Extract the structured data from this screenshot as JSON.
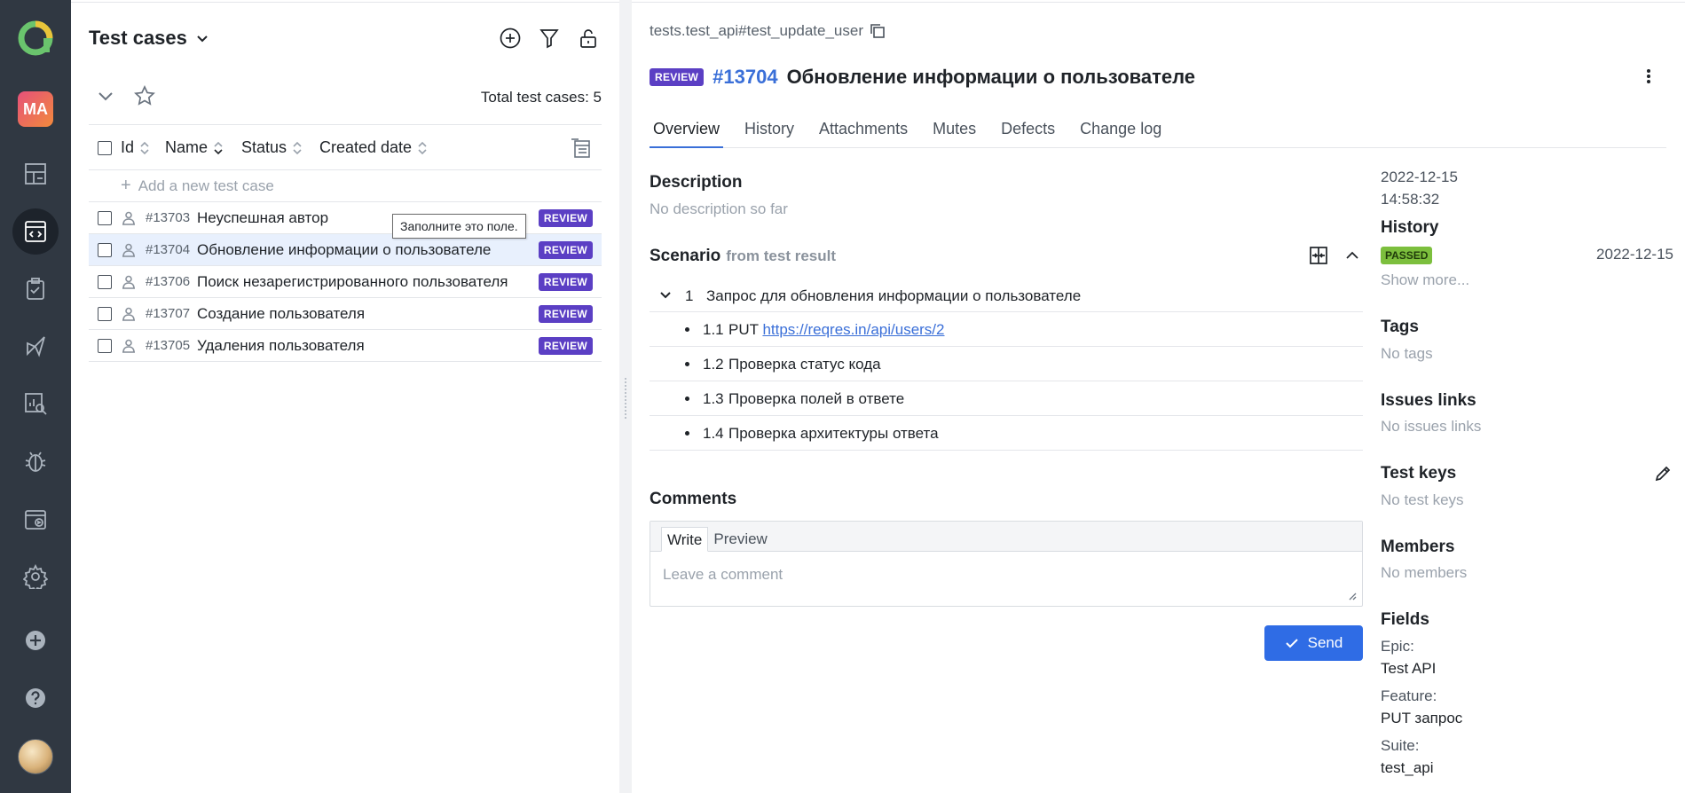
{
  "nav": {
    "avatar_initials": "MA",
    "items": [
      "dashboard-icon",
      "test-cases-icon",
      "test-plans-icon",
      "launches-icon",
      "analytics-icon",
      "defects-icon",
      "jobs-icon",
      "settings-icon",
      "add-project-icon",
      "help-icon"
    ],
    "active_item": "test-cases-icon"
  },
  "list": {
    "title": "Test cases",
    "total_label": "Total test cases: 5",
    "columns": [
      "Id",
      "Name",
      "Status",
      "Created date"
    ],
    "add_placeholder": "Add a new test case",
    "rows": [
      {
        "id": "#13703",
        "name": "Неуспешная автор",
        "badge": "REVIEW",
        "selected": false
      },
      {
        "id": "#13704",
        "name": "Обновление информации о пользователе",
        "badge": "REVIEW",
        "selected": true
      },
      {
        "id": "#13706",
        "name": "Поиск незарегистрированного пользователя",
        "badge": "REVIEW",
        "selected": false
      },
      {
        "id": "#13707",
        "name": "Создание пользователя",
        "badge": "REVIEW",
        "selected": false
      },
      {
        "id": "#13705",
        "name": "Удаления пользователя",
        "badge": "REVIEW",
        "selected": false
      }
    ],
    "tooltip": "Заполните это поле."
  },
  "detail": {
    "path": "tests.test_api#test_update_user",
    "badge": "REVIEW",
    "id": "#13704",
    "name": "Обновление информации о пользователе",
    "tabs": [
      "Overview",
      "History",
      "Attachments",
      "Mutes",
      "Defects",
      "Change log"
    ],
    "active_tab": "Overview",
    "description_title": "Description",
    "description_empty": "No description so far",
    "scenario_title": "Scenario",
    "scenario_from": "from test result",
    "step_main": {
      "num": "1",
      "text": "Запрос для обновления информации о пользователе"
    },
    "substeps": [
      {
        "num": "1.1",
        "prefix": "PUT",
        "link": "https://reqres.in/api/users/2"
      },
      {
        "num": "1.2",
        "text": "Проверка статус кода"
      },
      {
        "num": "1.3",
        "text": "Проверка полей в ответе"
      },
      {
        "num": "1.4",
        "text": "Проверка архитектуры ответа"
      }
    ],
    "comments_title": "Comments",
    "comment_tabs": [
      "Write",
      "Preview"
    ],
    "comment_placeholder": "Leave a comment",
    "send_label": "Send"
  },
  "side": {
    "created_date": "2022-12-15",
    "created_time": "14:58:32",
    "history_title": "History",
    "history_status": "PASSED",
    "history_date": "2022-12-15",
    "show_more": "Show more...",
    "tags_title": "Tags",
    "tags_empty": "No tags",
    "issues_title": "Issues links",
    "issues_empty": "No issues links",
    "keys_title": "Test keys",
    "keys_empty": "No test keys",
    "members_title": "Members",
    "members_empty": "No members",
    "fields_title": "Fields",
    "fields": [
      {
        "key": "Epic:",
        "value": "Test API"
      },
      {
        "key": "Feature:",
        "value": "PUT запрос"
      },
      {
        "key": "Suite:",
        "value": "test_api"
      }
    ]
  },
  "colors": {
    "nav_bg": "#303842",
    "accent": "#2f6ce5",
    "review_badge": "#5b3fc4",
    "passed_badge": "#7cbf3d",
    "link": "#3a6fd8"
  }
}
